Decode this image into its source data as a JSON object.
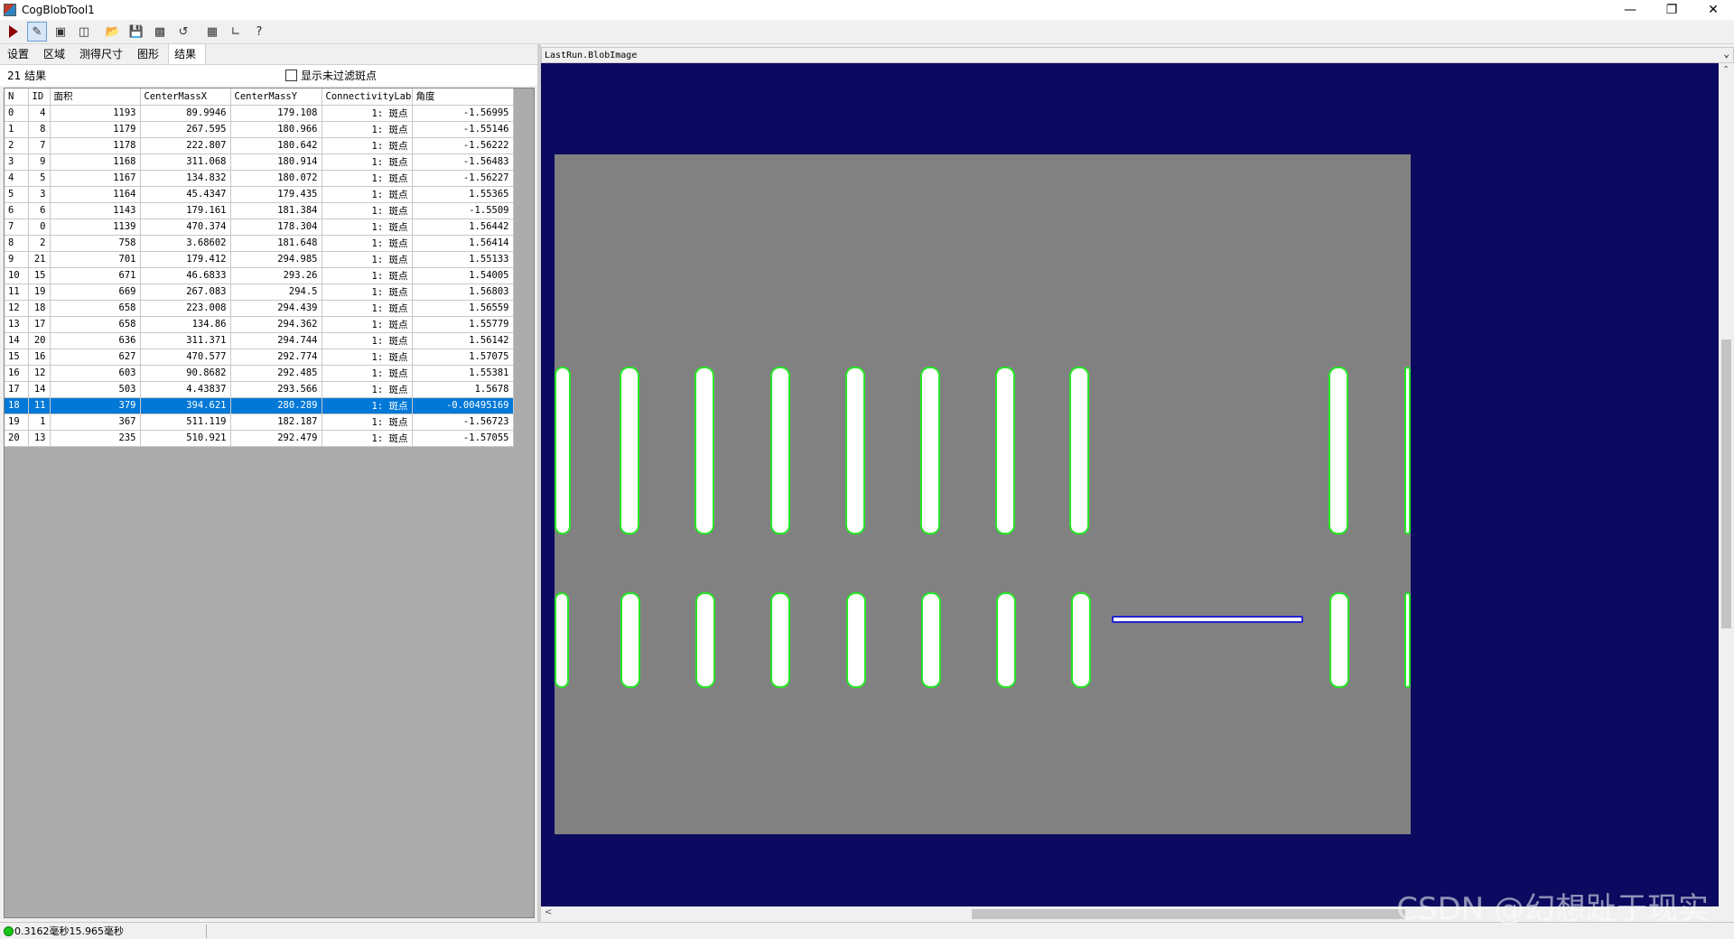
{
  "window": {
    "title": "CogBlobTool1"
  },
  "toolbar": {
    "icons": [
      "run-icon",
      "edit-pencil-icon",
      "input-image-icon",
      "blob-regions-icon",
      "open-folder-icon",
      "save-icon",
      "connections-icon",
      "reset-icon",
      "image-display-icon",
      "measure-icon",
      "help-icon"
    ]
  },
  "tabs": [
    {
      "label": "设置"
    },
    {
      "label": "区域"
    },
    {
      "label": "测得尺寸"
    },
    {
      "label": "图形"
    },
    {
      "label": "结果",
      "selected": true
    }
  ],
  "results": {
    "count_label": "21 结果",
    "show_unfiltered_label": "显示未过滤斑点",
    "columns": [
      "N",
      "ID",
      "面积",
      "CenterMassX",
      "CenterMassY",
      "ConnectivityLabel",
      "角度"
    ],
    "rows": [
      [
        "0",
        "4",
        "1193",
        "89.9946",
        "179.108",
        "1: 斑点",
        "-1.56995"
      ],
      [
        "1",
        "8",
        "1179",
        "267.595",
        "180.966",
        "1: 斑点",
        "-1.55146"
      ],
      [
        "2",
        "7",
        "1178",
        "222.807",
        "180.642",
        "1: 斑点",
        "-1.56222"
      ],
      [
        "3",
        "9",
        "1168",
        "311.068",
        "180.914",
        "1: 斑点",
        "-1.56483"
      ],
      [
        "4",
        "5",
        "1167",
        "134.832",
        "180.072",
        "1: 斑点",
        "-1.56227"
      ],
      [
        "5",
        "3",
        "1164",
        "45.4347",
        "179.435",
        "1: 斑点",
        "1.55365"
      ],
      [
        "6",
        "6",
        "1143",
        "179.161",
        "181.384",
        "1: 斑点",
        "-1.5509"
      ],
      [
        "7",
        "0",
        "1139",
        "470.374",
        "178.304",
        "1: 斑点",
        "1.56442"
      ],
      [
        "8",
        "2",
        "758",
        "3.68602",
        "181.648",
        "1: 斑点",
        "1.56414"
      ],
      [
        "9",
        "21",
        "701",
        "179.412",
        "294.985",
        "1: 斑点",
        "1.55133"
      ],
      [
        "10",
        "15",
        "671",
        "46.6833",
        "293.26",
        "1: 斑点",
        "1.54005"
      ],
      [
        "11",
        "19",
        "669",
        "267.083",
        "294.5",
        "1: 斑点",
        "1.56803"
      ],
      [
        "12",
        "18",
        "658",
        "223.008",
        "294.439",
        "1: 斑点",
        "1.56559"
      ],
      [
        "13",
        "17",
        "658",
        "134.86",
        "294.362",
        "1: 斑点",
        "1.55779"
      ],
      [
        "14",
        "20",
        "636",
        "311.371",
        "294.744",
        "1: 斑点",
        "1.56142"
      ],
      [
        "15",
        "16",
        "627",
        "470.577",
        "292.774",
        "1: 斑点",
        "1.57075"
      ],
      [
        "16",
        "12",
        "603",
        "90.8682",
        "292.485",
        "1: 斑点",
        "1.55381"
      ],
      [
        "17",
        "14",
        "503",
        "4.43837",
        "293.566",
        "1: 斑点",
        "1.5678"
      ],
      [
        "18",
        "11",
        "379",
        "394.621",
        "280.289",
        "1: 斑点",
        "-0.00495169"
      ],
      [
        "19",
        "1",
        "367",
        "511.119",
        "182.187",
        "1: 斑点",
        "-1.56723"
      ],
      [
        "20",
        "13",
        "235",
        "510.921",
        "292.479",
        "1: 斑点",
        "-1.57055"
      ]
    ],
    "selected_row": 18
  },
  "image_view": {
    "title": "LastRun.BlobImage",
    "background_color": "#0b0a60",
    "image_color": "#818181",
    "blob_outline_color": "#27e627",
    "selected_outline_color": "#2222d0"
  },
  "status": {
    "timing": "0.3162毫秒15.965毫秒",
    "status_color": "#19c619"
  },
  "watermark": "CSDN @幻想趾于现实"
}
